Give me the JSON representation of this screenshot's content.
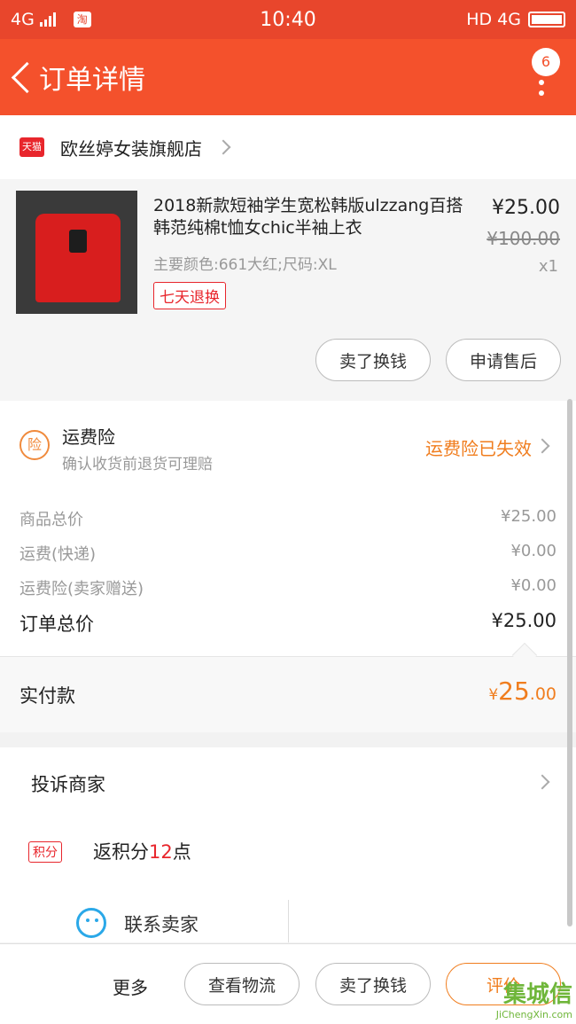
{
  "status_bar": {
    "network": "4G",
    "time": "10:40",
    "right": "HD 4G"
  },
  "nav": {
    "title": "订单详情",
    "badge": "6"
  },
  "shop": {
    "platform_tag": "天猫",
    "name": "欧丝婷女装旗舰店"
  },
  "product": {
    "title": "2018新款短袖学生宽松韩版ulzzang百搭韩范纯棉t恤女chic半袖上衣",
    "attrs": "主要颜色:661大红;尺码:XL",
    "tag": "七天退换",
    "price": "¥25.00",
    "original_price": "¥100.00",
    "qty": "x1",
    "buttons": [
      "卖了换钱",
      "申请售后"
    ]
  },
  "insurance": {
    "icon_label": "险",
    "title": "运费险",
    "subtitle": "确认收货前退货可理赔",
    "status": "运费险已失效"
  },
  "summary": [
    {
      "label": "商品总价",
      "value": "¥25.00"
    },
    {
      "label": "运费(快递)",
      "value": "¥0.00"
    },
    {
      "label": "运费险(卖家赠送)",
      "value": "¥0.00"
    }
  ],
  "total": {
    "label": "订单总价",
    "value": "¥25.00"
  },
  "paid": {
    "label": "实付款",
    "currency": "¥",
    "integer": "25",
    "decimal": ".00"
  },
  "actions": {
    "complain": "投诉商家",
    "points_tag": "积分",
    "points_prefix": "返积分",
    "points_value": "12",
    "points_suffix": "点",
    "contact": "联系卖家"
  },
  "bottom": {
    "more": "更多",
    "buttons": [
      "查看物流",
      "卖了换钱",
      "评价"
    ]
  },
  "watermark": {
    "title": "集城信",
    "sub": "JiChengXin.com"
  },
  "colors": {
    "brand": "#f4512c",
    "accent": "#f07d1e",
    "tmall_red": "#e8262c"
  }
}
